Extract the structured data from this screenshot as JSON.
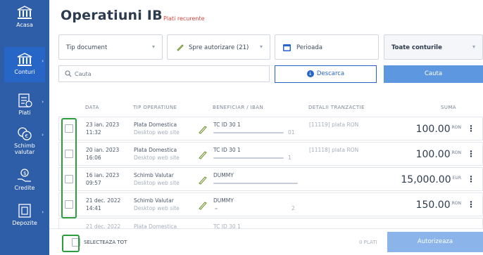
{
  "sidebar": {
    "items": [
      {
        "label": "Acasa",
        "icon": "bank-icon"
      },
      {
        "label": "Conturi",
        "icon": "bank-icon"
      },
      {
        "label": "Plati",
        "icon": "payments-icon"
      },
      {
        "label": "Schimb\nvalutar",
        "icon": "exchange-icon"
      },
      {
        "label": "Credite",
        "icon": "credit-icon"
      },
      {
        "label": "Depozite",
        "icon": "deposit-icon"
      }
    ]
  },
  "page": {
    "title": "Operatiuni IB",
    "subtitle": "Plati recurente"
  },
  "filters": {
    "doc_type": "Tip document",
    "status": "Spre autorizare (21)",
    "period": "Perioada",
    "accounts": "Toate conturile"
  },
  "search": {
    "placeholder": "Cauta",
    "download_label": "Descarca",
    "search_label": "Cauta"
  },
  "table": {
    "columns": [
      "DATA",
      "TIP OPERATIUNE",
      "BENEFICIAR / IBAN",
      "DETALII TRANZACTIE",
      "SUMA"
    ],
    "rows": [
      {
        "date": "23 ian. 2023",
        "time": "11:32",
        "type": "Plata Domestica",
        "channel": "Desktop web site",
        "beneficiary": "TC ID 30 1",
        "iban_tail": "01",
        "details": "[11119] plata RON",
        "amount": "100.00",
        "currency": "RON"
      },
      {
        "date": "20 ian. 2023",
        "time": "16:06",
        "type": "Plata Domestica",
        "channel": "Desktop web site",
        "beneficiary": "TC ID 30 1",
        "iban_tail": "1",
        "details": "[11118] plata RON",
        "amount": "100.00",
        "currency": "RON"
      },
      {
        "date": "16 ian. 2023",
        "time": "09:57",
        "type": "Schimb Valutar",
        "channel": "Desktop web site",
        "beneficiary": "DUMMY",
        "iban_tail": "",
        "details": "",
        "amount": "15,000.00",
        "currency": "EUR"
      },
      {
        "date": "21 dec. 2022",
        "time": "14:41",
        "type": "Schimb Valutar",
        "channel": "Desktop web site",
        "beneficiary": "DUMMY",
        "iban_tail": "2",
        "details": "",
        "amount": "150.00",
        "currency": "RON"
      },
      {
        "date": "21 dec. 2022",
        "time": "",
        "type": "Plata Domestica",
        "channel": "",
        "beneficiary": "TC ID 30 1",
        "iban_tail": "",
        "details": "",
        "amount": "",
        "currency": ""
      }
    ]
  },
  "footer": {
    "select_all": "SELECTEAZA TOT",
    "payments_count": "0 PLATI",
    "authorize_label": "Autorizeaza"
  },
  "colors": {
    "sidebar": "#2f5ea9",
    "accent": "#2766c7",
    "subtitle_red": "#d6453b",
    "highlight_green": "#2d9c3c"
  }
}
